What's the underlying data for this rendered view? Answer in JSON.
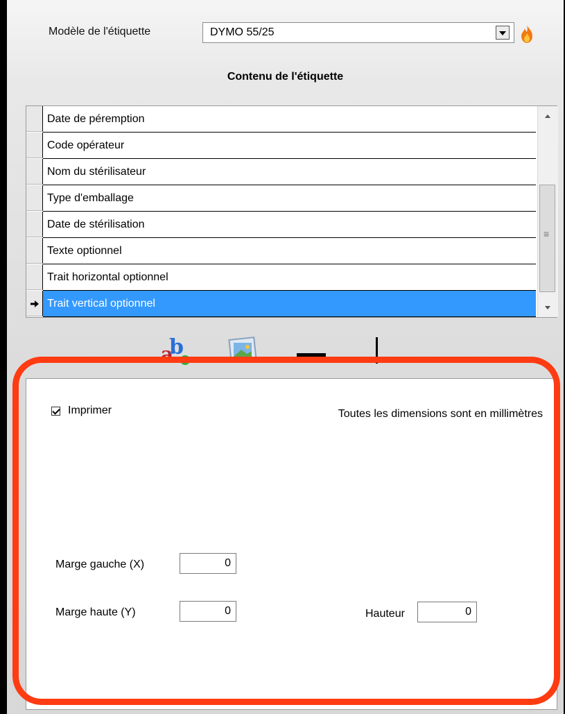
{
  "header": {
    "model_label": "Modèle de l'étiquette",
    "model_value": "DYMO 55/25",
    "section_title": "Contenu de l'étiquette"
  },
  "grid": {
    "rows": [
      {
        "label": "Date de péremption",
        "selected": false
      },
      {
        "label": "Code opérateur",
        "selected": false
      },
      {
        "label": "Nom du stérilisateur",
        "selected": false
      },
      {
        "label": "Type d'emballage",
        "selected": false
      },
      {
        "label": "Date de stérilisation",
        "selected": false
      },
      {
        "label": "Texte optionnel",
        "selected": false
      },
      {
        "label": "Trait horizontal optionnel",
        "selected": false
      },
      {
        "label": "Trait vertical optionnel",
        "selected": true
      }
    ]
  },
  "toolbar": {
    "icons": [
      "text-abc-icon",
      "image-icon",
      "horizontal-line-icon",
      "vertical-line-icon"
    ]
  },
  "properties": {
    "print_label": "Imprimer",
    "print_checked": true,
    "units_note": "Toutes les dimensions sont en millimètres",
    "margin_left_label": "Marge gauche (X)",
    "margin_left_value": "0",
    "margin_top_label": "Marge haute (Y)",
    "margin_top_value": "0",
    "height_label": "Hauteur",
    "height_value": "0"
  },
  "colors": {
    "selection": "#3399ff",
    "highlight_outline": "#ff3b12"
  }
}
